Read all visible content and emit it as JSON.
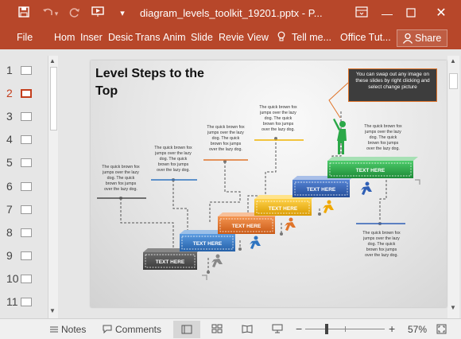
{
  "titlebar": {
    "doc_title": "diagram_levels_toolkit_19201.pptx - P...",
    "icons": [
      "save-icon",
      "undo-icon",
      "redo-icon",
      "present-from-beginning-icon",
      "customize-qat-icon"
    ]
  },
  "window_controls": [
    "minimize-icon",
    "restore-icon",
    "close-icon",
    "ribbon-display-icon"
  ],
  "ribbon": {
    "file_label": "File",
    "tabs": [
      "Hom",
      "Inser",
      "Desic",
      "Trans",
      "Anim",
      "Slide",
      "Revie",
      "View"
    ],
    "tell_me": "Tell me...",
    "office_tut": "Office Tut...",
    "share_label": "Share"
  },
  "thumbnails": {
    "numbers": [
      "1",
      "2",
      "3",
      "4",
      "5",
      "6",
      "7",
      "8",
      "9",
      "10",
      "11"
    ],
    "active_index": 1
  },
  "slide": {
    "title": "Level Steps to the Top",
    "callout_text": "You can swap out any image on these slides by right clicking and select change picture",
    "filler_text": "The quick brown fox jumps over the lazy dog. The quick brown fox jumps over the lazy dog.",
    "step_label": "TEXT HERE",
    "colors": {
      "step1": "#4a4a4a",
      "step2": "#2f74c0",
      "step3": "#e0742a",
      "step4": "#f0b400",
      "step5": "#2f5fb5",
      "step6": "#2ba848",
      "figure_green": "#2ba848",
      "figure_blue": "#2f5fb5",
      "figure_orange": "#e0742a",
      "figure_gray": "#888888"
    }
  },
  "statusbar": {
    "notes_label": "Notes",
    "comments_label": "Comments",
    "zoom_level": "57%"
  }
}
